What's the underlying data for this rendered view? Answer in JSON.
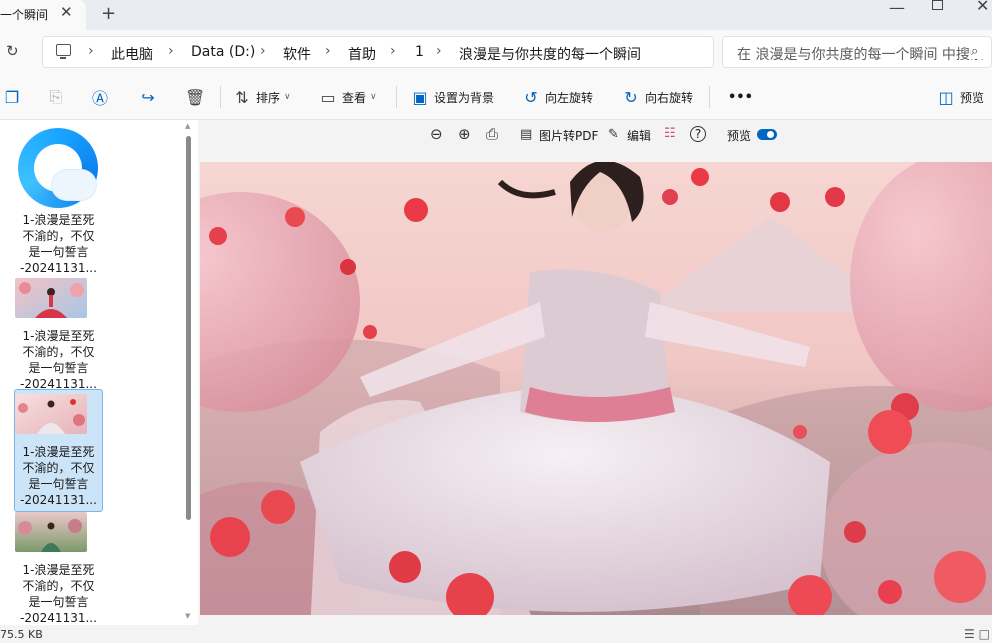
{
  "tab": {
    "title": "一个瞬间",
    "close": "✕",
    "new": "+"
  },
  "window": {
    "minimize": "—",
    "close": "✕"
  },
  "address": {
    "refresh": "↻",
    "separator": "›",
    "crumbs": [
      "此电脑",
      "Data (D:)",
      "软件",
      "首助",
      "1",
      "浪漫是与你共度的每一个瞬间"
    ],
    "search_placeholder": "在 浪漫是与你共度的每一个瞬间 中搜索"
  },
  "toolbar": {
    "sort": "排序",
    "view": "查看",
    "set_background": "设置为背景",
    "rotate_left": "向左旋转",
    "rotate_right": "向右旋转",
    "more": "•••",
    "preview": "预览"
  },
  "preview_bar": {
    "to_pdf": "图片转PDF",
    "edit": "编辑",
    "help": "?",
    "preview_toggle": "预览",
    "preview_on": true
  },
  "files": [
    {
      "caption": [
        "1-浪漫是至死",
        "不渝的，不仅",
        "是一句誓言",
        "-20241131..."
      ],
      "kind": "qq-logo",
      "selected": false
    },
    {
      "caption": [
        "1-浪漫是至死",
        "不渝的，不仅",
        "是一句誓言",
        "-20241131..."
      ],
      "kind": "image-red",
      "selected": false
    },
    {
      "caption": [
        "1-浪漫是至死",
        "不渝的，不仅",
        "是一句誓言",
        "-20241131..."
      ],
      "kind": "image-pink",
      "selected": true
    },
    {
      "caption": [
        "1-浪漫是至死",
        "不渝的，不仅",
        "是一句誓言",
        "-20241131..."
      ],
      "kind": "image-green",
      "selected": false
    }
  ],
  "status": {
    "size": "75.5 KB"
  },
  "colors": {
    "accent": "#0067c0",
    "selected_bg": "#cce4f7"
  }
}
